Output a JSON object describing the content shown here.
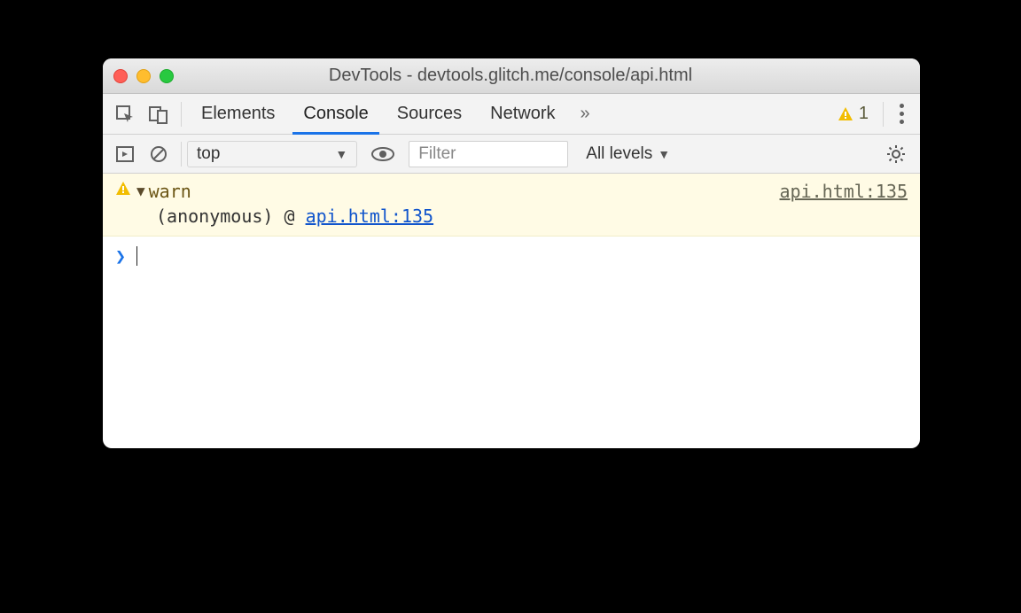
{
  "window": {
    "title": "DevTools - devtools.glitch.me/console/api.html"
  },
  "tabs": {
    "elements": "Elements",
    "console": "Console",
    "sources": "Sources",
    "network": "Network",
    "more_glyph": "»",
    "warning_count": "1"
  },
  "toolbar": {
    "context": "top",
    "filter_placeholder": "Filter",
    "levels": "All levels"
  },
  "log": {
    "warn_text": "warn",
    "warn_source": "api.html:135",
    "trace_label": "(anonymous) @ ",
    "trace_link": "api.html:135"
  }
}
